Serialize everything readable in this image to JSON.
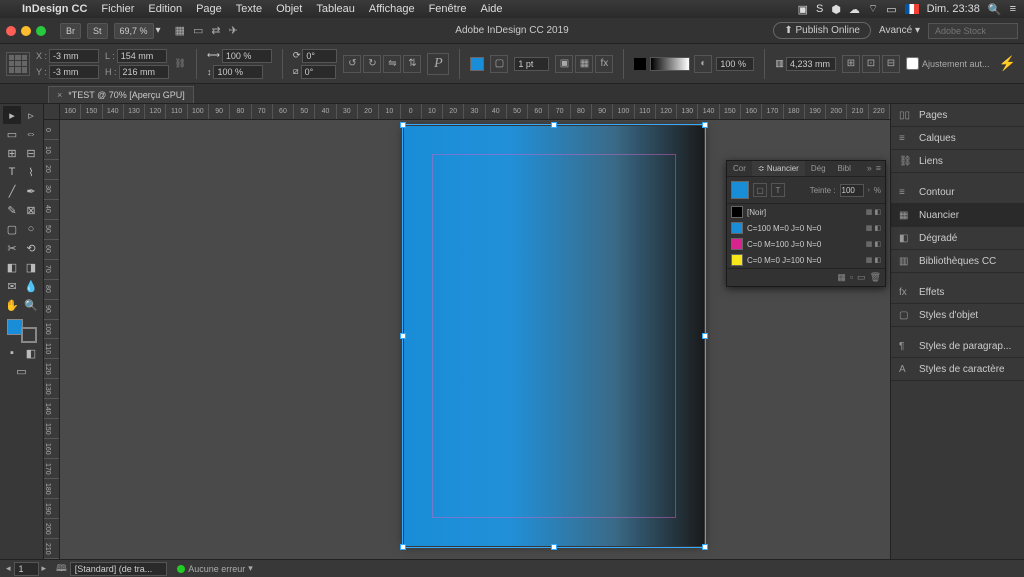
{
  "menubar": {
    "app_name": "InDesign CC",
    "items": [
      "Fichier",
      "Edition",
      "Page",
      "Texte",
      "Objet",
      "Tableau",
      "Affichage",
      "Fenêtre",
      "Aide"
    ],
    "clock": "Dim. 23:38"
  },
  "appbar": {
    "mode_label_1": "Br",
    "mode_label_2": "St",
    "zoom": "69,7 %",
    "title": "Adobe InDesign CC 2019",
    "publish": "Publish Online",
    "workspace": "Avancé",
    "stock_placeholder": "Adobe Stock"
  },
  "ctrl": {
    "x_label": "X :",
    "x_val": "-3 mm",
    "y_label": "Y :",
    "y_val": "-3 mm",
    "w_label": "L :",
    "w_val": "154 mm",
    "h_label": "H :",
    "h_val": "216 mm",
    "scale_x": "100 %",
    "scale_y": "100 %",
    "rotate": "0°",
    "shear": "0°",
    "stroke_weight": "1 pt",
    "opacity": "100 %",
    "col_width": "4,233 mm",
    "fit_label": "Ajustement aut..."
  },
  "doc_tab": {
    "label": "*TEST @ 70% [Aperçu GPU]"
  },
  "ruler_h": [
    "160",
    "150",
    "140",
    "130",
    "120",
    "110",
    "100",
    "90",
    "80",
    "70",
    "60",
    "50",
    "40",
    "30",
    "20",
    "10",
    "0",
    "10",
    "20",
    "30",
    "40",
    "50",
    "60",
    "70",
    "80",
    "90",
    "100",
    "110",
    "120",
    "130",
    "140",
    "150",
    "160",
    "170",
    "180",
    "190",
    "200",
    "210",
    "220"
  ],
  "ruler_v": [
    "0",
    "10",
    "20",
    "30",
    "40",
    "50",
    "60",
    "70",
    "80",
    "90",
    "100",
    "110",
    "120",
    "130",
    "140",
    "150",
    "160",
    "170",
    "180",
    "190",
    "200",
    "210"
  ],
  "right_panels": {
    "pages": "Pages",
    "calques": "Calques",
    "liens": "Liens",
    "contour": "Contour",
    "nuancier": "Nuancier",
    "degrade": "Dégradé",
    "biblio": "Bibliothèques CC",
    "effets": "Effets",
    "styles_objet": "Styles d'objet",
    "styles_para": "Styles de paragrap...",
    "styles_char": "Styles de caractère"
  },
  "swatches": {
    "tabs": [
      "Cor",
      "Nuancier",
      "Dég",
      "Bibl"
    ],
    "teinte_label": "Teinte :",
    "teinte_val": "100",
    "teinte_unit": "%",
    "rows": [
      {
        "name": "[Noir]",
        "color": "#000000"
      },
      {
        "name": "C=100 M=0 J=0 N=0",
        "color": "#1a8dd8"
      },
      {
        "name": "C=0 M=100 J=0 N=0",
        "color": "#d8238f"
      },
      {
        "name": "C=0 M=0 J=100 N=0",
        "color": "#f7e71a"
      }
    ]
  },
  "statusbar": {
    "page": "1",
    "master": "[Standard] (de tra...",
    "errors": "Aucune erreur"
  }
}
